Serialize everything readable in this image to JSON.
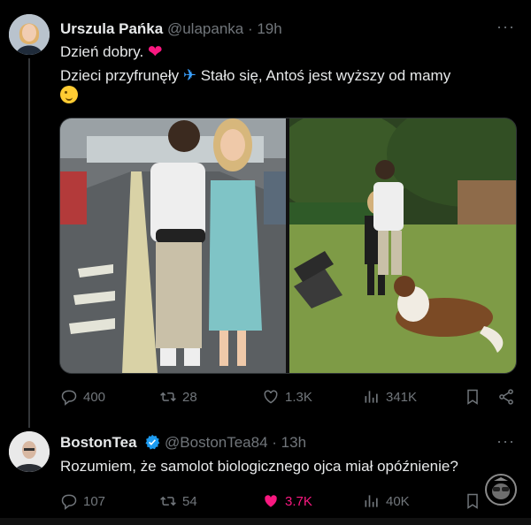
{
  "tweet1": {
    "display_name": "Urszula Pańka",
    "handle": "@ulapanka",
    "time": "· 19h",
    "line1": "Dzień dobry.",
    "line2_a": "Dzieci przyfrunęły",
    "line2_b": "Stało się, Antoś  jest wyższy  od mamy",
    "stats": {
      "replies": "400",
      "retweets": "28",
      "likes": "1.3K",
      "views": "341K"
    }
  },
  "tweet2": {
    "display_name": "BostonTea",
    "handle": "@BostonTea84",
    "time": "· 13h",
    "text": "Rozumiem, że samolot biologicznego ojca miał opóźnienie?",
    "stats": {
      "replies": "107",
      "retweets": "54",
      "likes": "3.7K",
      "views": "40K"
    }
  },
  "more_label": "···",
  "colors": {
    "background": "#000000",
    "muted": "#71767b",
    "like": "#f91880",
    "verified": "#1d9bf0"
  },
  "icons": [
    "more-icon",
    "heart-emoji-icon",
    "airplane-emoji-icon",
    "wink-emoji-icon",
    "reply-icon",
    "retweet-icon",
    "like-icon",
    "views-icon",
    "bookmark-icon",
    "share-icon",
    "verified-badge-icon"
  ]
}
